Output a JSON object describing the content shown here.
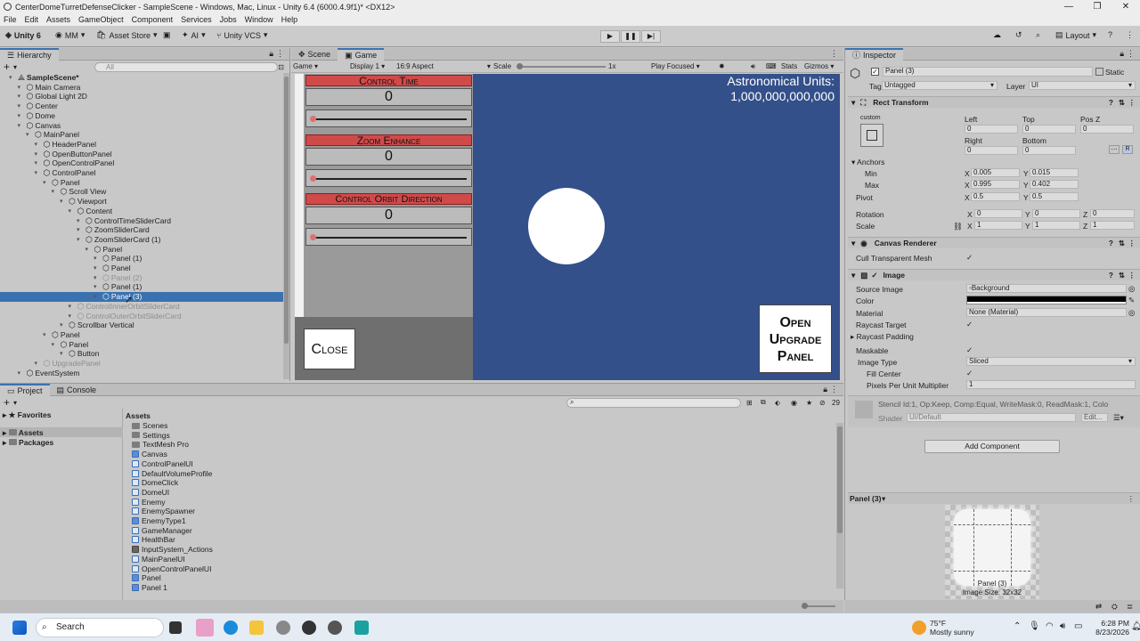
{
  "window": {
    "title": "CenterDomeTurretDefenseClicker - SampleScene - Windows, Mac, Linux - Unity 6.4 (6000.4.9f1)* <DX12>",
    "controls": [
      "—",
      "❐",
      "✕"
    ]
  },
  "menu": [
    "File",
    "Edit",
    "Assets",
    "GameObject",
    "Component",
    "Services",
    "Jobs",
    "Window",
    "Help"
  ],
  "toolbar": {
    "unity": "Unity 6",
    "account": "MM",
    "asset_store": "Asset Store",
    "ai": "AI",
    "vcs": "Unity VCS",
    "layout": "Layout"
  },
  "hierarchy": {
    "tab": "Hierarchy",
    "search_placeholder": "All",
    "items": [
      {
        "label": "SampleScene*",
        "depth": 0,
        "bold": true
      },
      {
        "label": "Main Camera",
        "depth": 1
      },
      {
        "label": "Global Light 2D",
        "depth": 1
      },
      {
        "label": "Center",
        "depth": 1
      },
      {
        "label": "Dome",
        "depth": 1
      },
      {
        "label": "Canvas",
        "depth": 1
      },
      {
        "label": "MainPanel",
        "depth": 2
      },
      {
        "label": "HeaderPanel",
        "depth": 3
      },
      {
        "label": "OpenButtonPanel",
        "depth": 3
      },
      {
        "label": "OpenControlPanel",
        "depth": 3
      },
      {
        "label": "ControlPanel",
        "depth": 3
      },
      {
        "label": "Panel",
        "depth": 4
      },
      {
        "label": "Scroll View",
        "depth": 5
      },
      {
        "label": "Viewport",
        "depth": 6
      },
      {
        "label": "Content",
        "depth": 7
      },
      {
        "label": "ControlTimeSliderCard",
        "depth": 8
      },
      {
        "label": "ZoomSliderCard",
        "depth": 8
      },
      {
        "label": "ZoomSliderCard (1)",
        "depth": 8
      },
      {
        "label": "Panel",
        "depth": 9
      },
      {
        "label": "Panel (1)",
        "depth": 10
      },
      {
        "label": "Panel",
        "depth": 10
      },
      {
        "label": "Panel (2)",
        "depth": 10,
        "dim": true
      },
      {
        "label": "Panel (1)",
        "depth": 10
      },
      {
        "label": "Panel (3)",
        "depth": 10,
        "selected": true
      },
      {
        "label": "ControlInnerOrbitSliderCard",
        "depth": 7,
        "dim": true
      },
      {
        "label": "ControlOuterOrbitSliderCard",
        "depth": 7,
        "dim": true
      },
      {
        "label": "Scrollbar Vertical",
        "depth": 6
      },
      {
        "label": "Panel",
        "depth": 4
      },
      {
        "label": "Panel",
        "depth": 5
      },
      {
        "label": "Button",
        "depth": 6
      },
      {
        "label": "UpgradePanel",
        "depth": 3,
        "dim": true
      },
      {
        "label": "EventSystem",
        "depth": 1
      }
    ]
  },
  "view_tabs": {
    "scene": "Scene",
    "game": "Game"
  },
  "game_bar": {
    "mode": "Game",
    "display": "Display 1",
    "aspect": "16:9 Aspect",
    "scale_label": "Scale",
    "scale_value": "1x",
    "play_focused": "Play Focused",
    "stats": "Stats",
    "gizmos": "Gizmos"
  },
  "game": {
    "cards": [
      {
        "title": "Control Time",
        "value": "0",
        "slider": 0.0
      },
      {
        "title": "Zoom Enhance",
        "value": "0",
        "slider": 0.0
      },
      {
        "title": "Control Orbit Direction",
        "value": "0",
        "slider": 0.0
      }
    ],
    "close_label": "Close",
    "units_label": "Astronomical Units:",
    "units_value": "1,000,000,000,000",
    "upgrade_label": "Open Upgrade Panel",
    "colors": {
      "space": "#34508a",
      "card_title": "#d14a4a"
    }
  },
  "inspector": {
    "tab": "Inspector",
    "object_name": "Panel (3)",
    "static_label": "Static",
    "tag_label": "Tag",
    "tag_value": "Untagged",
    "layer_label": "Layer",
    "layer_value": "UI",
    "rect_transform": "Rect Transform",
    "custom": "custom",
    "left_label": "Left",
    "left": "0",
    "top_label": "Top",
    "top": "0",
    "posz_label": "Pos Z",
    "posz": "0",
    "right_label": "Right",
    "right": "0",
    "bottom_label": "Bottom",
    "bottom": "0",
    "anchors": "Anchors",
    "min_label": "Min",
    "min_x": "0.005",
    "min_y": "0.015",
    "max_label": "Max",
    "max_x": "0.995",
    "max_y": "0.402",
    "pivot_label": "Pivot",
    "pivot_x": "0.5",
    "pivot_y": "0.5",
    "rotation_label": "Rotation",
    "rot_x": "0",
    "rot_y": "0",
    "rot_z": "0",
    "scale_label": "Scale",
    "scale_x": "1",
    "scale_y": "1",
    "scale_z": "1",
    "canvas_renderer": "Canvas Renderer",
    "cull_label": "Cull Transparent Mesh",
    "image": "Image",
    "source_image_label": "Source Image",
    "source_image": "Background",
    "color_label": "Color",
    "material_label": "Material",
    "material": "None (Material)",
    "raycast_target_label": "Raycast Target",
    "raycast_padding_label": "Raycast Padding",
    "maskable_label": "Maskable",
    "image_type_label": "Image Type",
    "image_type": "Sliced",
    "fill_center_label": "Fill Center",
    "ppu_label": "Pixels Per Unit Multiplier",
    "ppu": "1",
    "stencil": "Stencil Id:1, Op:Keep, Comp:Equal, WriteMask:0, ReadMask:1, Colo",
    "shader_label": "Shader",
    "shader": "UI/Default",
    "edit": "Edit...",
    "add_component": "Add Component",
    "preview_title": "Panel (3)",
    "preview_name": "Panel (3)",
    "preview_size": "Image Size: 32x32"
  },
  "bottom": {
    "project_tab": "Project",
    "console_tab": "Console",
    "favorites": "Favorites",
    "assets_root": "Assets",
    "packages": "Packages",
    "breadcrumb": "Assets",
    "count": "29",
    "assets": [
      {
        "name": "Scenes",
        "kind": "folder"
      },
      {
        "name": "Settings",
        "kind": "folder"
      },
      {
        "name": "TextMesh Pro",
        "kind": "folder"
      },
      {
        "name": "Canvas",
        "kind": "prefab"
      },
      {
        "name": "ControlPanelUI",
        "kind": "script"
      },
      {
        "name": "DefaultVolumeProfile",
        "kind": "script"
      },
      {
        "name": "DomeClick",
        "kind": "script"
      },
      {
        "name": "DomeUI",
        "kind": "script"
      },
      {
        "name": "Enemy",
        "kind": "script"
      },
      {
        "name": "EnemySpawner",
        "kind": "script"
      },
      {
        "name": "EnemyType1",
        "kind": "prefab"
      },
      {
        "name": "GameManager",
        "kind": "script"
      },
      {
        "name": "HealthBar",
        "kind": "script"
      },
      {
        "name": "InputSystem_Actions",
        "kind": "input"
      },
      {
        "name": "MainPanelUI",
        "kind": "script"
      },
      {
        "name": "OpenControlPanelUI",
        "kind": "script"
      },
      {
        "name": "Panel",
        "kind": "prefab"
      },
      {
        "name": "Panel 1",
        "kind": "prefab"
      }
    ]
  },
  "taskbar": {
    "search": "Search",
    "weather_temp": "75°F",
    "weather_desc": "Mostly sunny",
    "time": "6:28 PM",
    "date": "8/23/2026"
  }
}
